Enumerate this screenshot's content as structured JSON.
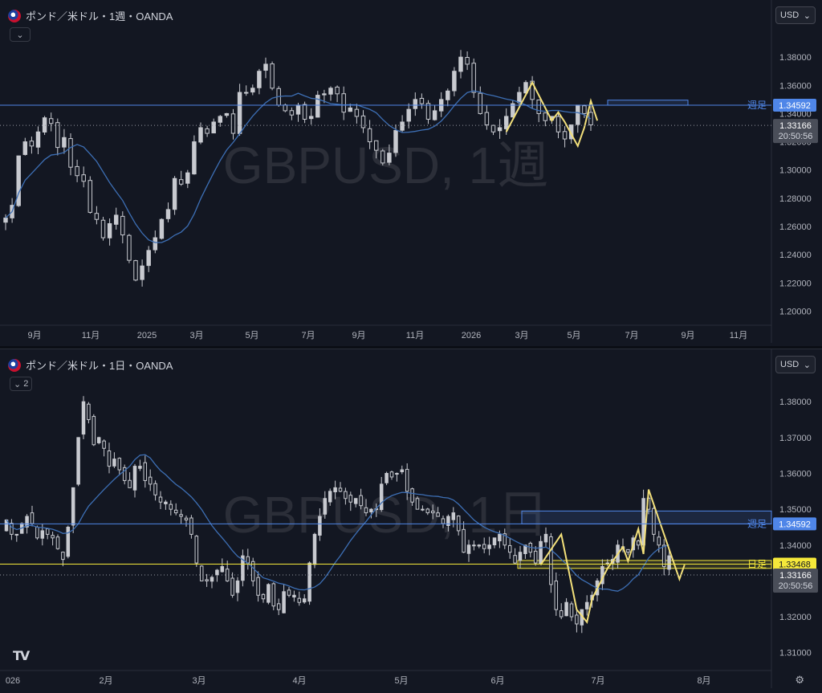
{
  "panes": [
    {
      "legend": {
        "title": "ポンド／米ドル・1週・OANDA"
      },
      "collapse_label": "⌄",
      "currency": {
        "label": "USD",
        "chevron": "⌄"
      },
      "watermark": "GBPUSD, 1週",
      "price_scale": {
        "ticks": [
          "1.38000",
          "1.36000",
          "1.34000",
          "1.32000",
          "1.30000",
          "1.28000",
          "1.26000",
          "1.24000",
          "1.22000",
          "1.20000"
        ]
      },
      "time_axis": {
        "labels": [
          "9月",
          "11月",
          "2025",
          "3月",
          "5月",
          "7月",
          "9月",
          "11月",
          "2026",
          "3月",
          "5月",
          "7月",
          "9月",
          "11月"
        ]
      },
      "levels": [
        {
          "name": "週足",
          "price_label": "1.34592",
          "color": "#4f86e8"
        }
      ],
      "current_price": {
        "price": "1.33166",
        "countdown": "20:50:56"
      }
    },
    {
      "legend": {
        "title": "ポンド／米ドル・1日・OANDA"
      },
      "collapse_label": "2",
      "currency": {
        "label": "USD",
        "chevron": "⌄"
      },
      "watermark": "GBPUSD, 1日",
      "price_scale": {
        "ticks": [
          "1.38000",
          "1.37000",
          "1.36000",
          "1.35000",
          "1.34000",
          "1.33000",
          "1.32000",
          "1.31000"
        ]
      },
      "time_axis": {
        "labels": [
          "026",
          "2月",
          "3月",
          "4月",
          "5月",
          "6月",
          "7月",
          "8月"
        ]
      },
      "levels": [
        {
          "name": "週足",
          "price_label": "1.34592",
          "color": "#4f86e8"
        },
        {
          "name": "日足",
          "price_label": "1.33468",
          "color": "#f5e83a"
        }
      ],
      "current_price": {
        "price": "1.33166",
        "countdown": "20:50:56"
      }
    }
  ],
  "icons": {
    "logo": "tradingview-logo-icon",
    "settings": "gear-icon",
    "flag": "uk-us-flag-icon"
  },
  "colors": {
    "background": "#131722",
    "candle": "#c8cad0",
    "ma": "#3d6fb5",
    "weekly_level": "#4f86e8",
    "daily_level": "#f5e83a",
    "zigzag": "#f3e07a"
  },
  "chart_data": [
    {
      "type": "candlestick",
      "title": "ポンド／米ドル・1週・OANDA",
      "ylim": [
        1.19,
        1.4
      ],
      "x_ticks": [
        "9月",
        "11月",
        "2025",
        "3月",
        "5月",
        "7月",
        "9月",
        "11月",
        "2026",
        "3月",
        "5月",
        "7月",
        "9月",
        "11月"
      ],
      "closes": [
        1.266,
        1.275,
        1.31,
        1.32,
        1.317,
        1.327,
        1.337,
        1.333,
        1.316,
        1.323,
        1.302,
        1.296,
        1.292,
        1.27,
        1.265,
        1.252,
        1.262,
        1.268,
        1.254,
        1.236,
        1.222,
        1.232,
        1.243,
        1.252,
        1.265,
        1.272,
        1.294,
        1.29,
        1.298,
        1.32,
        1.33,
        1.326,
        1.334,
        1.338,
        1.34,
        1.326,
        1.355,
        1.355,
        1.358,
        1.37,
        1.375,
        1.358,
        1.346,
        1.342,
        1.339,
        1.346,
        1.336,
        1.338,
        1.353,
        1.354,
        1.358,
        1.354,
        1.341,
        1.344,
        1.338,
        1.33,
        1.32,
        1.314,
        1.305,
        1.312,
        1.328,
        1.334,
        1.343,
        1.35,
        1.347,
        1.336,
        1.342,
        1.35,
        1.356,
        1.37,
        1.38,
        1.375,
        1.355,
        1.34,
        1.332,
        1.327,
        1.33,
        1.338,
        1.347,
        1.355,
        1.362,
        1.35,
        1.34,
        1.335,
        1.338,
        1.327,
        1.322,
        1.332,
        1.346,
        1.34,
        1.332
      ],
      "ma_name": "MA",
      "levels": [
        {
          "name": "週足",
          "value": 1.34592
        }
      ],
      "zigzag": [
        [
          77,
          1.327
        ],
        [
          81,
          1.362
        ],
        [
          84,
          1.335
        ],
        [
          85,
          1.341
        ],
        [
          86,
          1.334
        ],
        [
          88,
          1.317
        ],
        [
          89,
          1.33
        ],
        [
          90,
          1.349
        ],
        [
          91,
          1.335
        ]
      ],
      "current_price": 1.33166
    },
    {
      "type": "candlestick",
      "title": "ポンド／米ドル・1日・OANDA",
      "ylim": [
        1.305,
        1.387
      ],
      "x_ticks": [
        "026",
        "2月",
        "3月",
        "4月",
        "5月",
        "6月",
        "7月",
        "8月"
      ],
      "closes": [
        1.347,
        1.343,
        1.343,
        1.346,
        1.348,
        1.346,
        1.342,
        1.344,
        1.343,
        1.342,
        1.339,
        1.336,
        1.345,
        1.356,
        1.37,
        1.38,
        1.375,
        1.368,
        1.37,
        1.367,
        1.362,
        1.364,
        1.361,
        1.358,
        1.356,
        1.362,
        1.362,
        1.358,
        1.357,
        1.354,
        1.352,
        1.352,
        1.35,
        1.349,
        1.348,
        1.347,
        1.343,
        1.335,
        1.33,
        1.33,
        1.331,
        1.333,
        1.334,
        1.33,
        1.326,
        1.33,
        1.337,
        1.335,
        1.33,
        1.326,
        1.325,
        1.329,
        1.323,
        1.322,
        1.327,
        1.326,
        1.326,
        1.324,
        1.325,
        1.335,
        1.343,
        1.348,
        1.353,
        1.355,
        1.356,
        1.355,
        1.353,
        1.352,
        1.353,
        1.351,
        1.349,
        1.35,
        1.35,
        1.357,
        1.36,
        1.359,
        1.36,
        1.361,
        1.355,
        1.352,
        1.35,
        1.35,
        1.349,
        1.349,
        1.348,
        1.346,
        1.348,
        1.349,
        1.344,
        1.338,
        1.34,
        1.34,
        1.34,
        1.339,
        1.34,
        1.342,
        1.343,
        1.34,
        1.338,
        1.335,
        1.338,
        1.34,
        1.338,
        1.335,
        1.341,
        1.343,
        1.329,
        1.322,
        1.32,
        1.324,
        1.32,
        1.318,
        1.322,
        1.324,
        1.326,
        1.33,
        1.334,
        1.335,
        1.336,
        1.34,
        1.339,
        1.338,
        1.342,
        1.34,
        1.353,
        1.35,
        1.343,
        1.34,
        1.334,
        1.337
      ],
      "ma_name": "MA",
      "levels": [
        {
          "name": "週足",
          "value": 1.34592
        },
        {
          "name": "日足",
          "value": 1.33468
        }
      ],
      "weekly_zone": [
        1.3459,
        1.3495
      ],
      "daily_zone": [
        1.3335,
        1.3357
      ],
      "zigzag": [
        [
          104,
          1.3345
        ],
        [
          108,
          1.343
        ],
        [
          111,
          1.322
        ],
        [
          113,
          1.3185
        ],
        [
          114,
          1.325
        ],
        [
          117,
          1.3335
        ],
        [
          120,
          1.3395
        ],
        [
          121,
          1.3355
        ],
        [
          123,
          1.3445
        ],
        [
          124,
          1.3375
        ],
        [
          125,
          1.3555
        ],
        [
          128,
          1.343
        ],
        [
          131,
          1.3305
        ],
        [
          132,
          1.3345
        ]
      ],
      "current_price": 1.33166
    }
  ]
}
